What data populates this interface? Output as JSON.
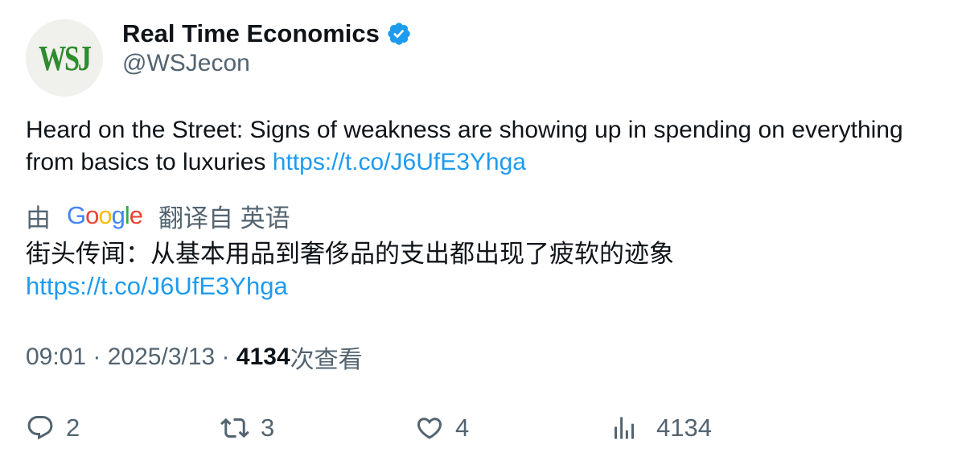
{
  "author": {
    "avatar_text": "WSJ",
    "display_name": "Real Time Economics",
    "handle": "@WSJecon",
    "verified_icon": "verified-badge-icon"
  },
  "tweet": {
    "text": "Heard on the Street: Signs of weakness are showing up in spending on everything from basics to luxuries ",
    "link": "https://t.co/J6UfE3Yhga"
  },
  "translation": {
    "prefix": "由",
    "provider": "Google",
    "suffix": "翻译自 英语",
    "text": "街头传闻：从基本用品到奢侈品的支出都出现了疲软的迹象",
    "link": "https://t.co/J6UfE3Yhga"
  },
  "meta": {
    "time": "09:01",
    "separator": " · ",
    "date": "2025/3/13",
    "views_count": "4134",
    "views_label": "次查看"
  },
  "actions": {
    "replies": "2",
    "retweets": "3",
    "likes": "4",
    "views": "4134"
  },
  "colors": {
    "link": "#1d9bf0",
    "secondary_text": "#536471",
    "primary_text": "#0f1419",
    "verified": "#1d9bf0",
    "wsj_green": "#2e8b2e"
  }
}
